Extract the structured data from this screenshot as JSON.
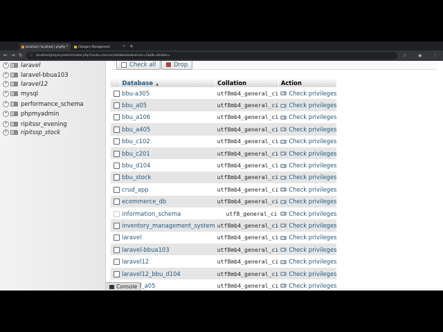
{
  "browser": {
    "tabs": [
      {
        "label": "localhost / localhost | phpMy",
        "active": true,
        "favicon_color": "#f29111"
      },
      {
        "label": "Category Management",
        "active": false,
        "favicon_color": "#f4b400"
      }
    ],
    "new_tab": "+",
    "tab_close": "×",
    "url": "localhost/phpmyadmin/index.php?route=/server/databases&server=1&db=&table=",
    "nav": {
      "back": "←",
      "forward": "→",
      "reload": "↻"
    },
    "toolbar_icons": {
      "bookmark": "☆",
      "profile": "◉",
      "menu": "⋮"
    }
  },
  "navigation_tree": [
    {
      "name": "laravel",
      "italic": true
    },
    {
      "name": "laravel-bbua103",
      "italic": false
    },
    {
      "name": "laravel12",
      "italic": true
    },
    {
      "name": "mysql",
      "italic": false
    },
    {
      "name": "performance_schema",
      "italic": false
    },
    {
      "name": "phpmyadmin",
      "italic": false
    },
    {
      "name": "ripitssr_evening",
      "italic": false
    },
    {
      "name": "ripitssp_stock",
      "italic": true
    }
  ],
  "top_actions": {
    "check_all": "Check all",
    "drop": "Drop"
  },
  "table": {
    "headers": {
      "database": "Database",
      "collation": "Collation",
      "action": "Action"
    },
    "sort_indicator": "▲",
    "rows": [
      {
        "name": "bbu-a305",
        "collation": "utf8mb4_general_ci",
        "action": "Check privileges"
      },
      {
        "name": "bbu_a05",
        "collation": "utf8mb4_general_ci",
        "action": "Check privileges"
      },
      {
        "name": "bbu_a106",
        "collation": "utf8mb4_general_ci",
        "action": "Check privileges"
      },
      {
        "name": "bbu_a405",
        "collation": "utf8mb4_general_ci",
        "action": "Check privileges"
      },
      {
        "name": "bbu_c102",
        "collation": "utf8mb4_general_ci",
        "action": "Check privileges"
      },
      {
        "name": "bbu_c201",
        "collation": "utf8mb4_general_ci",
        "action": "Check privileges"
      },
      {
        "name": "bbu_d104",
        "collation": "utf8mb4_general_ci",
        "action": "Check privileges"
      },
      {
        "name": "bbu_stock",
        "collation": "utf8mb4_general_ci",
        "action": "Check privileges"
      },
      {
        "name": "crud_app",
        "collation": "utf8mb4_general_ci",
        "action": "Check privileges"
      },
      {
        "name": "ecommerce_db",
        "collation": "utf8mb4_general_ci",
        "action": "Check privileges"
      },
      {
        "name": "information_schema",
        "collation": "utf8_general_ci",
        "action": "Check privileges",
        "system": true
      },
      {
        "name": "inventory_management_system",
        "collation": "utf8mb4_general_ci",
        "action": "Check privileges"
      },
      {
        "name": "laravel",
        "collation": "utf8mb4_general_ci",
        "action": "Check privileges"
      },
      {
        "name": "laravel-bbua103",
        "collation": "utf8mb4_general_ci",
        "action": "Check privileges"
      },
      {
        "name": "laravel12",
        "collation": "utf8mb4_general_ci",
        "action": "Check privileges"
      },
      {
        "name": "laravel12_bbu_d104",
        "collation": "utf8mb4_general_ci",
        "action": "Check privileges"
      },
      {
        "name": "laravel_a05",
        "collation": "utf8mb4_general_ci",
        "action": "Check privileges"
      }
    ]
  },
  "console": {
    "label": "Console"
  }
}
